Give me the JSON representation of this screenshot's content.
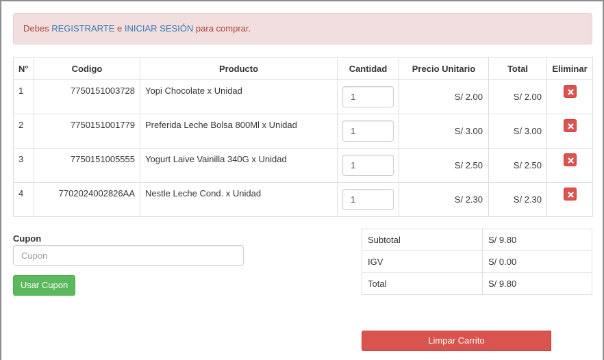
{
  "alert": {
    "prefix": "Debes ",
    "register_link": "REGISTRARTE",
    "middle": " e ",
    "login_link": "INICIAR SESIÓN",
    "suffix": " para comprar."
  },
  "cart": {
    "headers": {
      "num": "N°",
      "code": "Codigo",
      "product": "Producto",
      "quantity": "Cantidad",
      "unit_price": "Precio Unitario",
      "total": "Total",
      "delete": "Eliminar"
    },
    "rows": [
      {
        "num": "1",
        "code": "7750151003728",
        "product": "Yopi Chocolate x Unidad",
        "qty": "1",
        "unit_price": "S/ 2.00",
        "total": "S/ 2.00"
      },
      {
        "num": "2",
        "code": "7750151001779",
        "product": "Preferida Leche Bolsa 800Ml x Unidad",
        "qty": "1",
        "unit_price": "S/ 3.00",
        "total": "S/ 3.00"
      },
      {
        "num": "3",
        "code": "7750151005555",
        "product": "Yogurt Laive Vainilla 340G x Unidad",
        "qty": "1",
        "unit_price": "S/ 2.50",
        "total": "S/ 2.50"
      },
      {
        "num": "4",
        "code": "7702024002826AA",
        "product": "Nestle Leche Cond. x Unidad",
        "qty": "1",
        "unit_price": "S/ 2.30",
        "total": "S/ 2.30"
      }
    ]
  },
  "coupon": {
    "label": "Cupon",
    "placeholder": "Cupon",
    "value": "",
    "button": "Usar Cupon"
  },
  "totals": {
    "subtotal_label": "Subtotal",
    "subtotal_value": "S/ 9.80",
    "igv_label": "IGV",
    "igv_value": "S/ 0.00",
    "total_label": "Total",
    "total_value": "S/ 9.80"
  },
  "actions": {
    "clear_cart": "Limpar Carrito"
  },
  "icons": {
    "delete": "remove-icon"
  },
  "colors": {
    "alert_bg": "#f2dede",
    "alert_text": "#a94442",
    "link": "#337ab7",
    "success": "#5cb85c",
    "danger": "#d9534f"
  }
}
